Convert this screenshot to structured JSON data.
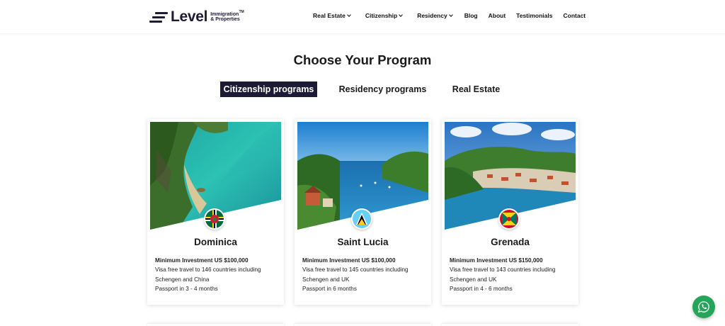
{
  "header": {
    "logo": {
      "word": "Level",
      "sub_line1": "Immigration",
      "sub_line2": "& Properties",
      "tm": "TM"
    },
    "nav": [
      {
        "label": "Real Estate",
        "dropdown": true
      },
      {
        "label": "Citizenship",
        "dropdown": true
      },
      {
        "label": "Residency",
        "dropdown": true
      },
      {
        "label": "Blog",
        "dropdown": false
      },
      {
        "label": "About",
        "dropdown": false
      },
      {
        "label": "Testimonials",
        "dropdown": false
      },
      {
        "label": "Contact",
        "dropdown": false
      }
    ]
  },
  "main": {
    "title": "Choose Your Program",
    "tabs": [
      {
        "label": "Citizenship programs",
        "active": true
      },
      {
        "label": "Residency programs",
        "active": false
      },
      {
        "label": "Real Estate",
        "active": false
      }
    ],
    "cards": [
      {
        "name": "Dominica",
        "min_investment": "Minimum Investment US $100,000",
        "visa": "Visa free travel to 146 countries including Schengen and China",
        "passport": "Passport in 3 - 4 months",
        "flag": "dominica-flag"
      },
      {
        "name": "Saint Lucia",
        "min_investment": "Minimum Investment US $100,000",
        "visa": "Visa free travel to 145 countries including Schengen and UK",
        "passport": "Passport in 6 months",
        "flag": "saint-lucia-flag"
      },
      {
        "name": "Grenada",
        "min_investment": "Minimum Investment US $150,000",
        "visa": "Visa free travel to 143 countries including Schengen and UK",
        "passport": "Passport in 4 - 6 months",
        "flag": "grenada-flag"
      }
    ]
  },
  "whatsapp": {
    "icon": "whatsapp-icon"
  },
  "colors": {
    "brand_navy": "#1c1a35",
    "whatsapp_green": "#25a55a"
  }
}
